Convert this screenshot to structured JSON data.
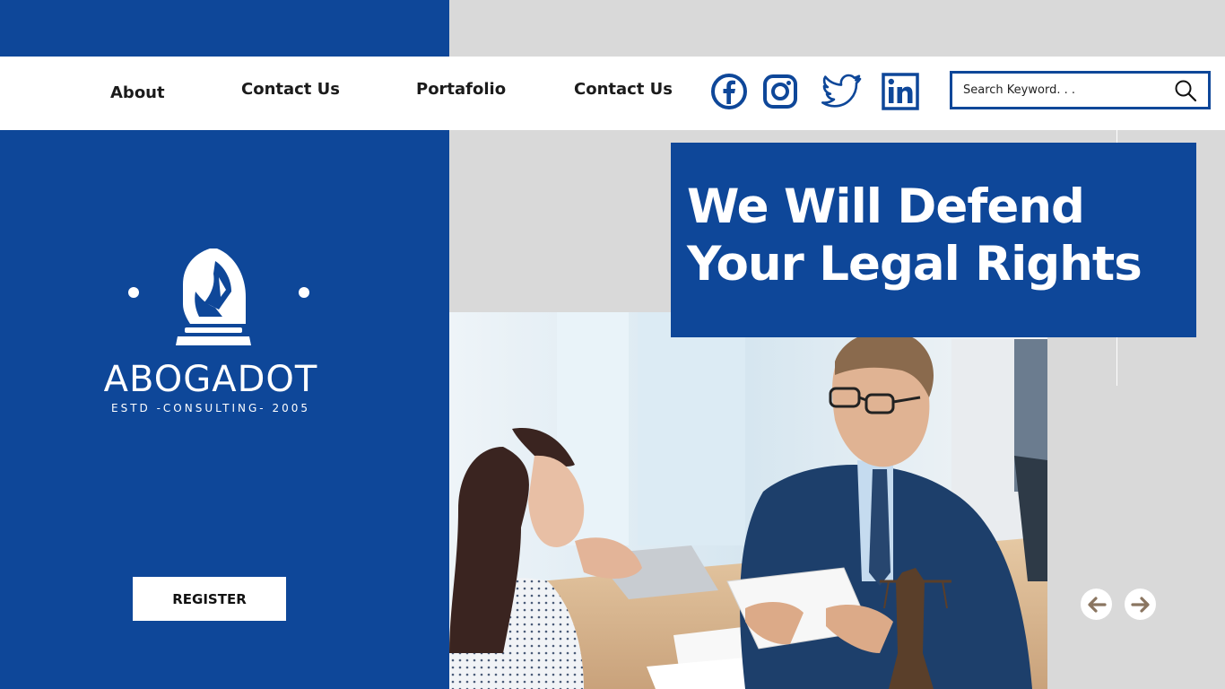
{
  "nav": {
    "items": [
      {
        "label": "About"
      },
      {
        "label": "Contact Us"
      },
      {
        "label": "Portafolio"
      },
      {
        "label": "Contact Us"
      }
    ]
  },
  "social": {
    "icons": [
      "facebook-icon",
      "instagram-icon",
      "twitter-icon",
      "linkedin-icon"
    ]
  },
  "search": {
    "placeholder": "Search Keyword. . .",
    "value": ""
  },
  "logo": {
    "brand": "ABOGADOT",
    "tagline": "ESTD -CONSULTING- 2005",
    "icon": "chess-knight-icon"
  },
  "register_label": "REGISTER",
  "hero": {
    "headline": "We Will Defend Your Legal Rights"
  },
  "slider": {
    "prev_icon": "arrow-left-icon",
    "next_icon": "arrow-right-icon"
  },
  "colors": {
    "brand_blue": "#0e4799",
    "background_grey": "#d9d9d9",
    "arrow_color": "#8a7560"
  }
}
